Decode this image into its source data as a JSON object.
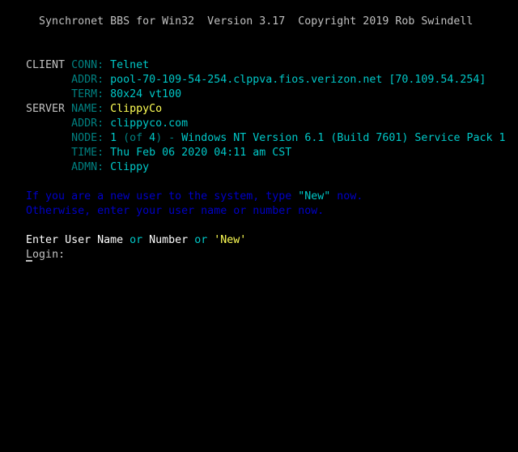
{
  "banner": "  Synchronet BBS for Win32  Version 3.17  Copyright 2019 Rob Swindell",
  "client": {
    "section": "CLIENT",
    "conn_label": "CONN: ",
    "conn_value": "Telnet",
    "addr_label": "ADDR: ",
    "addr_value": "pool-70-109-54-254.clppva.fios.verizon.net [70.109.54.254]",
    "term_label": "TERM: ",
    "term_value": "80x24 vt100"
  },
  "server": {
    "section": "SERVER",
    "name_label": "NAME: ",
    "name_value": "ClippyCo",
    "addr_label": "ADDR: ",
    "addr_value": "clippyco.com",
    "node_label": "NODE: ",
    "node_num": "1",
    "node_of_open": " (of ",
    "node_total": "4",
    "node_of_close": ")",
    "node_dash": " - ",
    "node_os": "Windows NT Version 6.1 (Build 7601) Service Pack 1",
    "time_label": "TIME: ",
    "time_value": "Thu Feb 06 2020 04:11 am CST",
    "admn_label": "ADMN: ",
    "admn_value": "Clippy"
  },
  "newuser": {
    "line1_a": "If you are a new user to the system, type ",
    "line1_new": "\"New\"",
    "line1_b": " now.",
    "line2": "Otherwise, enter your user name or number now."
  },
  "prompt": {
    "enter": "Enter User Name ",
    "or1": "or",
    "number": " Number ",
    "or2": "or",
    "new_word": " 'New'",
    "login_first": "L",
    "login_rest": "ogin:"
  },
  "colors": {
    "background": "#000000",
    "label_dim_cyan": "#008080",
    "value_cyan": "#00c8c8",
    "highlight_yellow": "#ffff55",
    "info_blue": "#0000c8",
    "text_grey": "#c0c0c0"
  }
}
